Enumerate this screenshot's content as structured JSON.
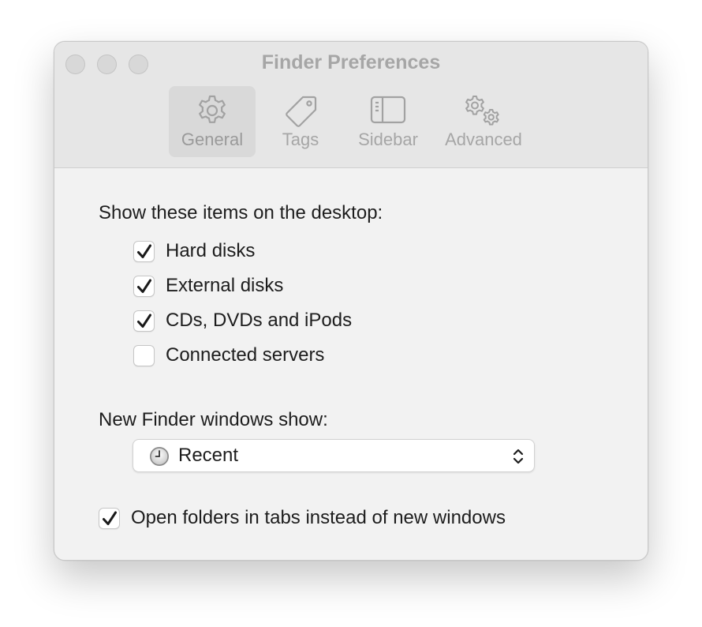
{
  "window": {
    "title": "Finder Preferences"
  },
  "toolbar": {
    "items": [
      {
        "label": "General",
        "icon": "gear-icon",
        "selected": true
      },
      {
        "label": "Tags",
        "icon": "tag-icon",
        "selected": false
      },
      {
        "label": "Sidebar",
        "icon": "sidebar-icon",
        "selected": false
      },
      {
        "label": "Advanced",
        "icon": "advanced-gears-icon",
        "selected": false
      }
    ]
  },
  "desktop_section": {
    "heading": "Show these items on the desktop:",
    "items": [
      {
        "label": "Hard disks",
        "checked": true
      },
      {
        "label": "External disks",
        "checked": true
      },
      {
        "label": "CDs, DVDs and iPods",
        "checked": true
      },
      {
        "label": "Connected servers",
        "checked": false
      }
    ]
  },
  "new_window_section": {
    "heading": "New Finder windows show:",
    "selected_value": "Recent",
    "icon": "clock-icon"
  },
  "tabs_option": {
    "label": "Open folders in tabs instead of new windows",
    "checked": true
  },
  "colors": {
    "window_bg": "#f2f2f2",
    "titlebar_bg": "#e6e6e6",
    "text": "#1d1d1d",
    "disabled_text": "#a6a6a6"
  }
}
